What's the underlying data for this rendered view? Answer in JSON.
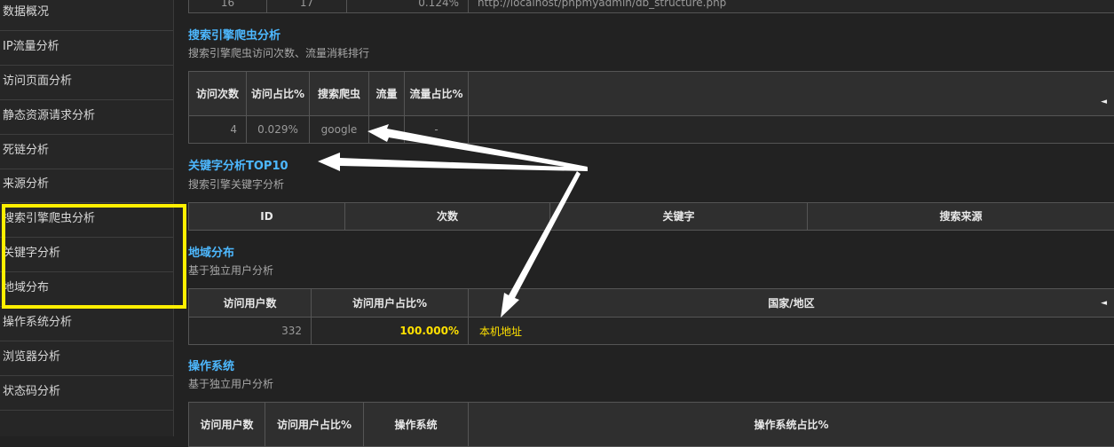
{
  "sidebar": {
    "items": [
      {
        "label": "数据概况"
      },
      {
        "label": "IP流量分析"
      },
      {
        "label": "访问页面分析"
      },
      {
        "label": "静态资源请求分析"
      },
      {
        "label": "死链分析"
      },
      {
        "label": "来源分析"
      },
      {
        "label": "搜索引擎爬虫分析"
      },
      {
        "label": "关键字分析"
      },
      {
        "label": "地域分布"
      },
      {
        "label": "操作系统分析"
      },
      {
        "label": "浏览器分析"
      },
      {
        "label": "状态码分析"
      }
    ]
  },
  "top_row": {
    "c1": "16",
    "c2": "17",
    "c3": "0.124%",
    "c4": "http://localhost/phpmyadmin/db_structure.php"
  },
  "crawler": {
    "title": "搜索引擎爬虫分析",
    "subtitle": "搜索引擎爬虫访问次数、流量消耗排行",
    "headers": [
      "访问次数",
      "访问占比%",
      "搜索爬虫",
      "流量",
      "流量占比%"
    ],
    "row": {
      "visits": "4",
      "ratio": "0.029%",
      "bot": "google",
      "traffic": "",
      "traffic_ratio": "-"
    },
    "sort_icon": "◄"
  },
  "keywords": {
    "title": "关键字分析TOP10",
    "subtitle": "搜索引擎关键字分析",
    "headers": [
      "ID",
      "次数",
      "关键字",
      "搜索来源"
    ]
  },
  "region": {
    "title": "地域分布",
    "subtitle": "基于独立用户分析",
    "headers": [
      "访问用户数",
      "访问用户占比%",
      "国家/地区"
    ],
    "row": {
      "users": "332",
      "ratio": "100.000%",
      "country": "本机地址"
    },
    "sort_icon": "◄"
  },
  "os": {
    "title": "操作系统",
    "subtitle": "基于独立用户分析",
    "headers": [
      "访问用户数",
      "访问用户占比%",
      "操作系统",
      "操作系统占比%"
    ]
  },
  "colors": {
    "highlight": "#ffef00",
    "link_title": "#4db8ff",
    "accent_value": "#ffe100"
  }
}
